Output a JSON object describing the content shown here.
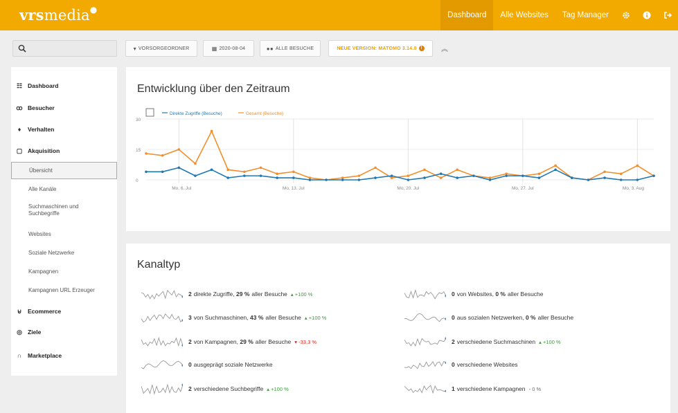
{
  "brand": {
    "logo_bold": "vrs",
    "logo_rest": "media",
    "accent": "#f2a900"
  },
  "topnav": {
    "items": [
      {
        "label": "Dashboard",
        "active": true
      },
      {
        "label": "Alle Websites",
        "active": false
      },
      {
        "label": "Tag Manager",
        "active": false
      }
    ],
    "icons": [
      "gear-icon",
      "info-icon",
      "logout-icon"
    ]
  },
  "search": {
    "placeholder": "",
    "value": ""
  },
  "controls": {
    "segment": "VORSORGEORDNER",
    "date": "2020-08-04",
    "visits": "ALLE BESUCHE",
    "update": "NEUE VERSION: MATOMO 3.14.0"
  },
  "sidebar": {
    "sections": [
      {
        "label": "Dashboard",
        "icon": "dashboard-icon"
      },
      {
        "label": "Besucher",
        "icon": "binoculars-icon"
      },
      {
        "label": "Verhalten",
        "icon": "bell-icon"
      },
      {
        "label": "Akquisition",
        "icon": "akquisition-icon"
      },
      {
        "label": "Ecommerce",
        "icon": "cart-icon"
      },
      {
        "label": "Ziele",
        "icon": "target-icon"
      },
      {
        "label": "Marketplace",
        "icon": "marketplace-icon"
      }
    ],
    "subitems": [
      {
        "label": "Übersicht",
        "active": true
      },
      {
        "label": "Alle Kanäle",
        "active": false
      },
      {
        "label": "Suchmaschinen und Suchbegriffe",
        "active": false
      },
      {
        "label": "Websites",
        "active": false
      },
      {
        "label": "Soziale Netzwerke",
        "active": false
      },
      {
        "label": "Kampagnen",
        "active": false
      },
      {
        "label": "Kampagnen URL Erzeuger",
        "active": false
      }
    ]
  },
  "evolution": {
    "title": "Entwicklung über den Zeitraum",
    "chart_data": {
      "type": "line",
      "x": [
        "2020-07-04",
        "2020-07-05",
        "2020-07-06",
        "2020-07-07",
        "2020-07-08",
        "2020-07-09",
        "2020-07-10",
        "2020-07-11",
        "2020-07-12",
        "2020-07-13",
        "2020-07-14",
        "2020-07-15",
        "2020-07-16",
        "2020-07-17",
        "2020-07-18",
        "2020-07-19",
        "2020-07-20",
        "2020-07-21",
        "2020-07-22",
        "2020-07-23",
        "2020-07-24",
        "2020-07-25",
        "2020-07-26",
        "2020-07-27",
        "2020-07-28",
        "2020-07-29",
        "2020-07-30",
        "2020-07-31",
        "2020-08-01",
        "2020-08-02",
        "2020-08-03",
        "2020-08-04"
      ],
      "tick_labels": [
        "Mo, 6. Jul",
        "Mo, 13. Jul",
        "Mo, 20. Jul",
        "Mo, 27. Jul",
        "Mo, 3. Aug"
      ],
      "y_ticks": [
        "0",
        "15",
        "30"
      ],
      "ylim": [
        0,
        30
      ],
      "series": [
        {
          "name": "Direkte Zugriffe (Besuche)",
          "color": "#1f78b4",
          "values": [
            4,
            4,
            6,
            2,
            5,
            1,
            2,
            2,
            1,
            1,
            0,
            0,
            0,
            0,
            1,
            2,
            0,
            1,
            3,
            1,
            2,
            0,
            2,
            2,
            1,
            5,
            1,
            0,
            1,
            0,
            0,
            2
          ]
        },
        {
          "name": "Gesamt (Besuche)",
          "color": "#f28e2b",
          "values": [
            13,
            12,
            15,
            8,
            24,
            5,
            4,
            6,
            3,
            4,
            1,
            0,
            1,
            2,
            6,
            1,
            2,
            5,
            1,
            5,
            2,
            1,
            3,
            2,
            3,
            7,
            1,
            0,
            4,
            3,
            7,
            2
          ]
        }
      ]
    }
  },
  "channels": {
    "title": "Kanaltyp",
    "left": [
      {
        "count": "2",
        "text": "direkte Zugriffe,",
        "pct": "29 %",
        "suffix": "aller Besuche",
        "evo": "+100 %",
        "trend": "pos"
      },
      {
        "count": "3",
        "text": "von Suchmaschinen,",
        "pct": "43 %",
        "suffix": "aller Besuche",
        "evo": "+100 %",
        "trend": "pos"
      },
      {
        "count": "2",
        "text": "von Kampagnen,",
        "pct": "29 %",
        "suffix": "aller Besuche",
        "evo": "-33,3 %",
        "trend": "neg"
      },
      {
        "count": "0",
        "text": "ausgeprägt soziale Netzwerke",
        "pct": "",
        "suffix": "",
        "evo": "",
        "trend": ""
      },
      {
        "count": "2",
        "text": "verschiedene Suchbegriffe",
        "pct": "",
        "suffix": "",
        "evo": "+100 %",
        "trend": "pos"
      }
    ],
    "right": [
      {
        "count": "0",
        "text": "von Websites,",
        "pct": "0 %",
        "suffix": "aller Besuche",
        "evo": "",
        "trend": ""
      },
      {
        "count": "0",
        "text": "aus sozialen Netzwerken,",
        "pct": "0 %",
        "suffix": "aller Besuche",
        "evo": "",
        "trend": ""
      },
      {
        "count": "2",
        "text": "verschiedene Suchmaschinen",
        "pct": "",
        "suffix": "",
        "evo": "+100 %",
        "trend": "pos"
      },
      {
        "count": "0",
        "text": "verschiedene Websites",
        "pct": "",
        "suffix": "",
        "evo": "",
        "trend": ""
      },
      {
        "count": "1",
        "text": "verschiedene Kampagnen",
        "pct": "",
        "suffix": "",
        "evo": "0 %",
        "trend": "zero"
      }
    ]
  }
}
